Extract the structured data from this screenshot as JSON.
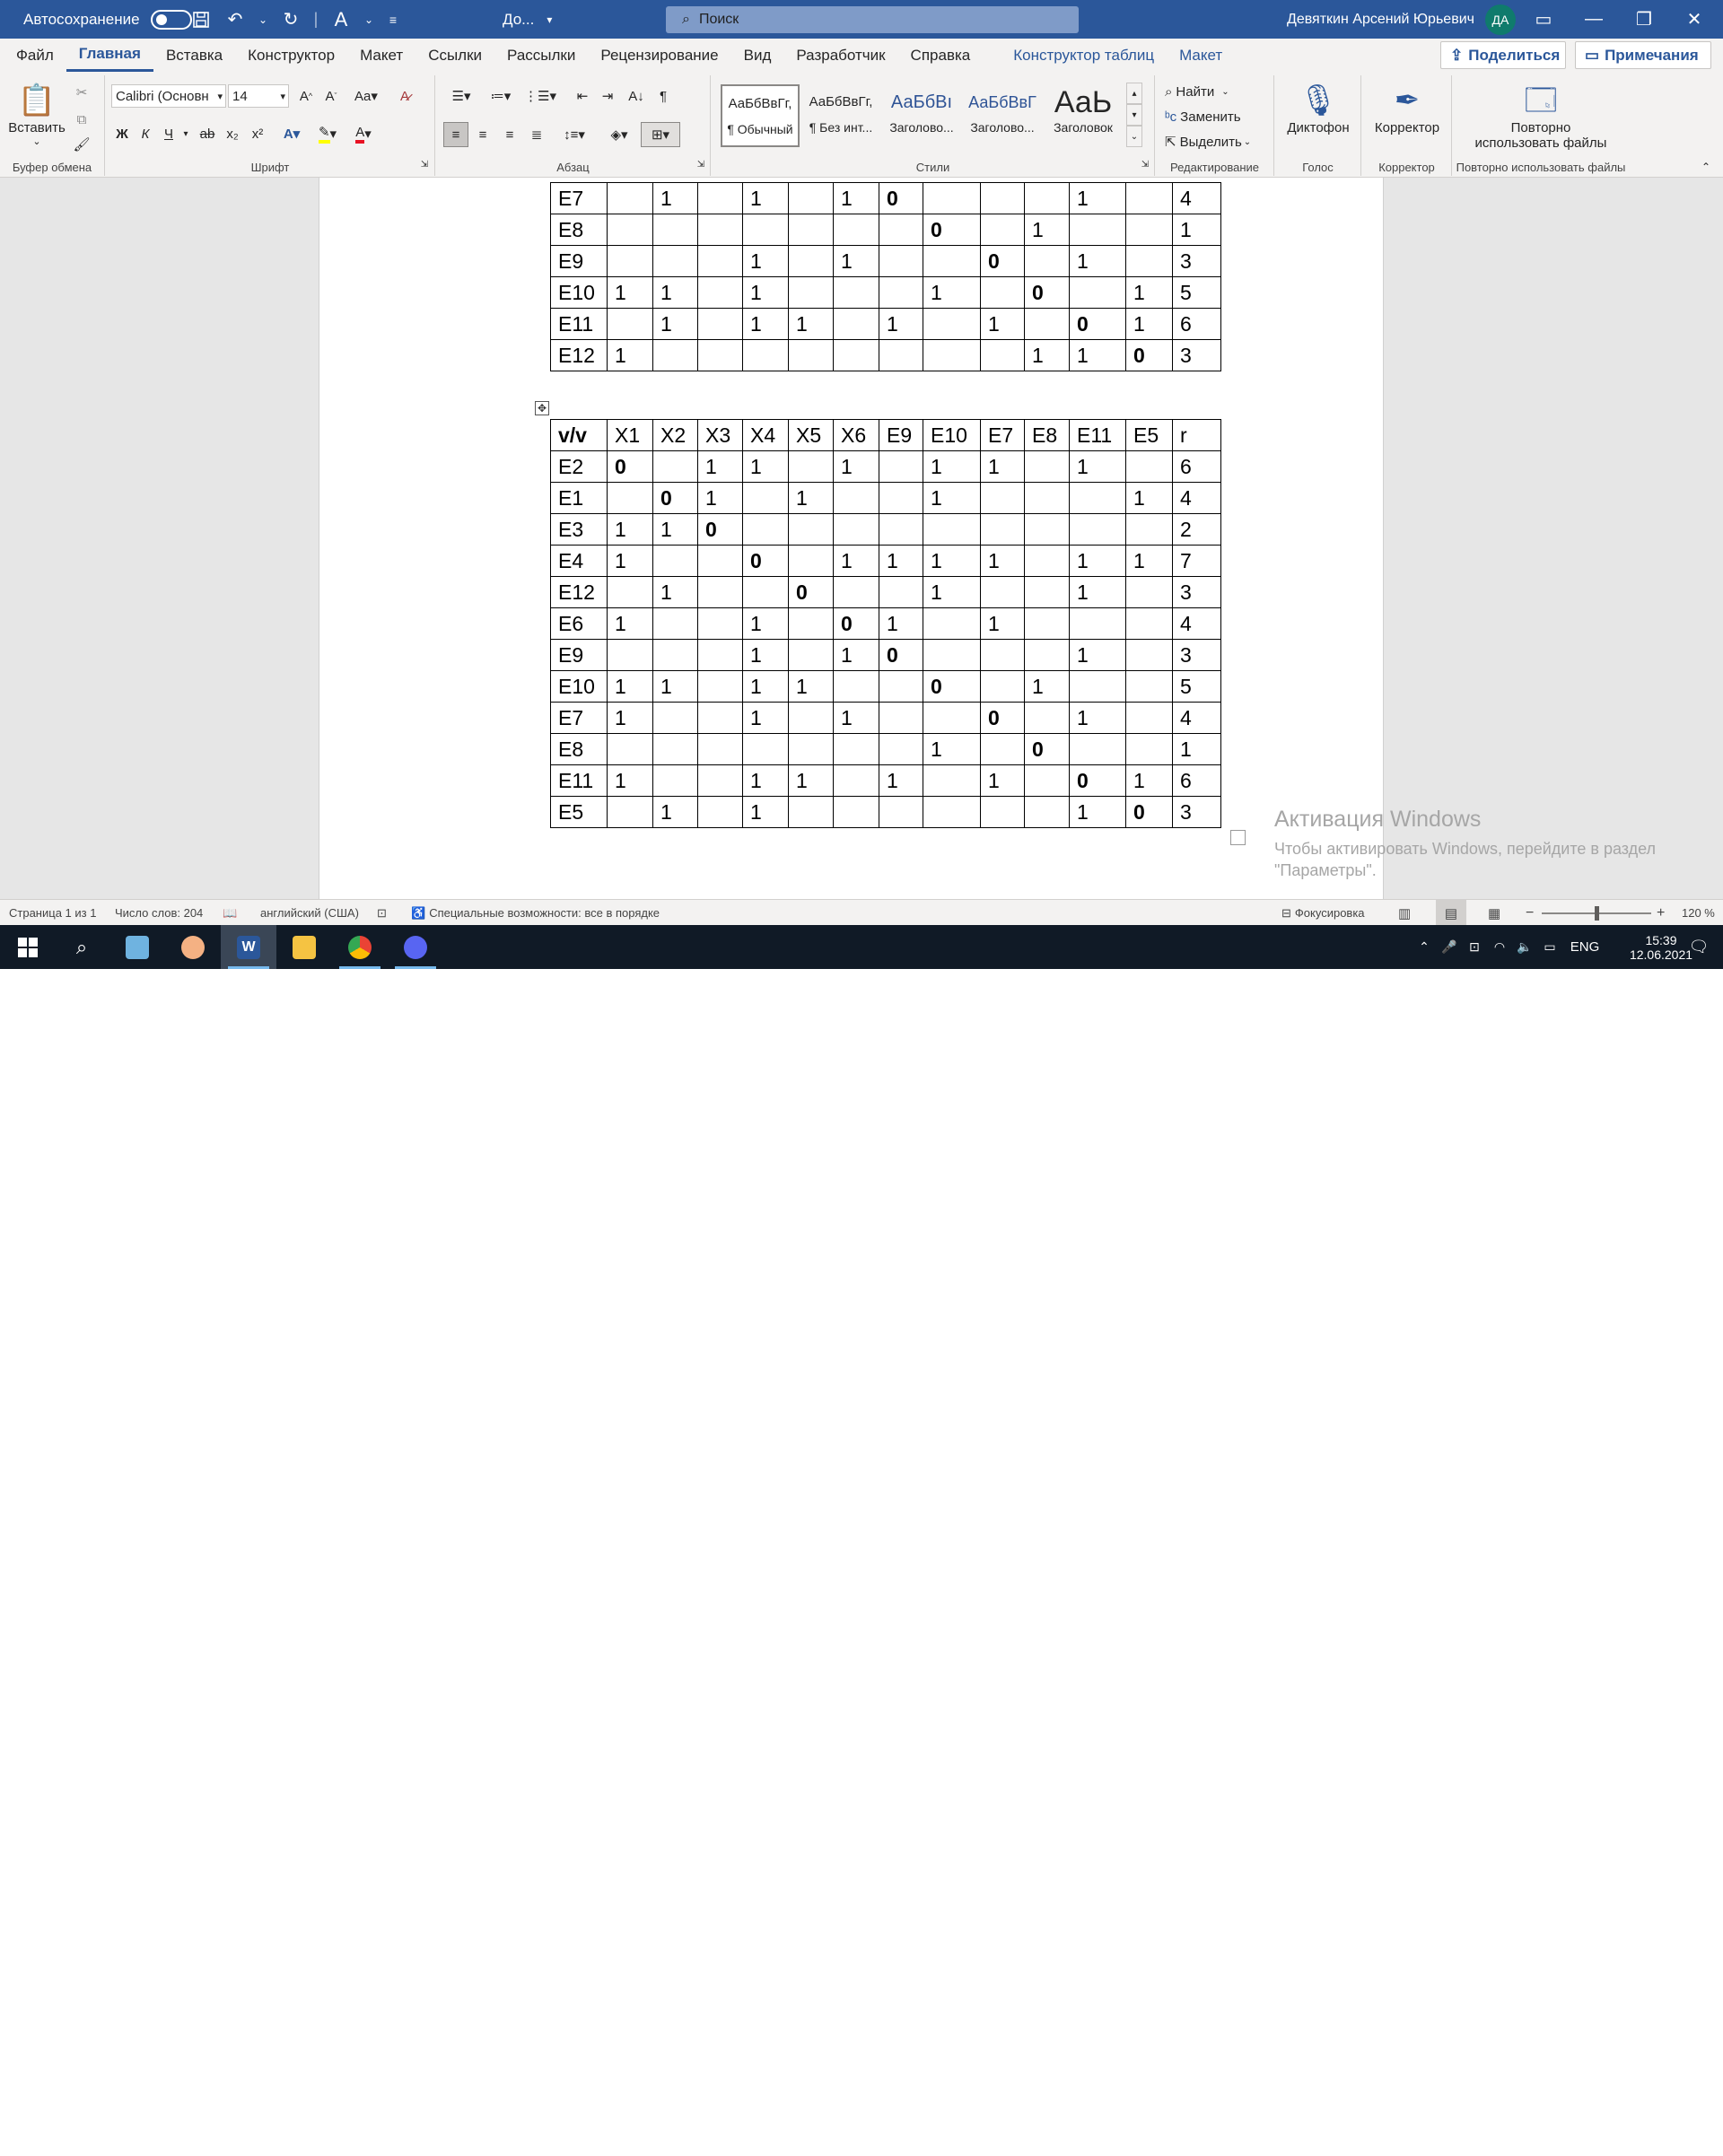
{
  "titlebar": {
    "autosave_label": "Автосохранение",
    "doc_name": "До...",
    "search_placeholder": "Поиск",
    "user_name": "Девяткин Арсений Юрьевич",
    "user_initials": "ДА"
  },
  "tabs": [
    "Файл",
    "Главная",
    "Вставка",
    "Конструктор",
    "Макет",
    "Ссылки",
    "Рассылки",
    "Рецензирование",
    "Вид",
    "Разработчик",
    "Справка",
    "Конструктор таблиц",
    "Макет"
  ],
  "share_label": "Поделиться",
  "comments_label": "Примечания",
  "ribbon": {
    "clipboard": {
      "paste": "Вставить",
      "label": "Буфер обмена"
    },
    "font": {
      "name": "Calibri (Основн",
      "size": "14",
      "label": "Шрифт",
      "bold": "Ж",
      "italic": "К",
      "underline": "Ч"
    },
    "paragraph": {
      "label": "Абзац"
    },
    "styles": {
      "label": "Стили",
      "items": [
        {
          "preview": "АаБбВвГг,",
          "name": "¶ Обычный"
        },
        {
          "preview": "АаБбВвГг,",
          "name": "¶ Без инт..."
        },
        {
          "preview": "АаБбВı",
          "name": "Заголово..."
        },
        {
          "preview": "АаБбВвГ",
          "name": "Заголово..."
        },
        {
          "preview": "АаЬ",
          "name": "Заголовок"
        }
      ]
    },
    "editing": {
      "find": "Найти",
      "replace": "Заменить",
      "select": "Выделить",
      "label": "Редактирование"
    },
    "voice": {
      "dictate": "Диктофон",
      "label": "Голос"
    },
    "editor": {
      "name": "Корректор",
      "label": "Корректор"
    },
    "reuse": {
      "name_line1": "Повторно",
      "name_line2": "использовать файлы",
      "label": "Повторно использовать файлы"
    }
  },
  "table1": {
    "rows": [
      {
        "cells": [
          "E7",
          "",
          "1",
          "",
          "1",
          "",
          "1",
          "0",
          "",
          "",
          "",
          "1",
          "",
          "4"
        ],
        "bold": [
          7
        ]
      },
      {
        "cells": [
          "E8",
          "",
          "",
          "",
          "",
          "",
          "",
          "",
          "0",
          "",
          "1",
          "",
          "",
          "1"
        ],
        "bold": [
          8
        ]
      },
      {
        "cells": [
          "E9",
          "",
          "",
          "",
          "1",
          "",
          "1",
          "",
          "",
          "0",
          "",
          "1",
          "",
          "3"
        ],
        "bold": [
          9
        ]
      },
      {
        "cells": [
          "E10",
          "1",
          "1",
          "",
          "1",
          "",
          "",
          "",
          "1",
          "",
          "0",
          "",
          "1",
          "5"
        ],
        "bold": [
          10
        ]
      },
      {
        "cells": [
          "E11",
          "",
          "1",
          "",
          "1",
          "1",
          "",
          "1",
          "",
          "1",
          "",
          "0",
          "1",
          "6"
        ],
        "bold": [
          11
        ]
      },
      {
        "cells": [
          "E12",
          "1",
          "",
          "",
          "",
          "",
          "",
          "",
          "",
          "",
          "1",
          "1",
          "0",
          "3"
        ],
        "bold": [
          12
        ]
      }
    ]
  },
  "table2": {
    "header": [
      "v/v",
      "X1",
      "X2",
      "X3",
      "X4",
      "X5",
      "X6",
      "E9",
      "E10",
      "E7",
      "E8",
      "E11",
      "E5",
      "r"
    ],
    "rows": [
      {
        "cells": [
          "E2",
          "0",
          "",
          "1",
          "1",
          "",
          "1",
          "",
          "1",
          "1",
          "",
          "1",
          "",
          "6"
        ],
        "bold": [
          1
        ]
      },
      {
        "cells": [
          "E1",
          "",
          "0",
          "1",
          "",
          "1",
          "",
          "",
          "1",
          "",
          "",
          "",
          "1",
          "4"
        ],
        "bold": [
          2
        ]
      },
      {
        "cells": [
          "E3",
          "1",
          "1",
          "0",
          "",
          "",
          "",
          "",
          "",
          "",
          "",
          "",
          "",
          "2"
        ],
        "bold": [
          3
        ]
      },
      {
        "cells": [
          "E4",
          "1",
          "",
          "",
          "0",
          "",
          "1",
          "1",
          "1",
          "1",
          "",
          "1",
          "1",
          "7"
        ],
        "bold": [
          4
        ]
      },
      {
        "cells": [
          "E12",
          "",
          "1",
          "",
          "",
          "0",
          "",
          "",
          "1",
          "",
          "",
          "1",
          "",
          "3"
        ],
        "bold": [
          5
        ]
      },
      {
        "cells": [
          "E6",
          "1",
          "",
          "",
          "1",
          "",
          "0",
          "1",
          "",
          "1",
          "",
          "",
          "",
          "4"
        ],
        "bold": [
          6
        ]
      },
      {
        "cells": [
          "E9",
          "",
          "",
          "",
          "1",
          "",
          "1",
          "0",
          "",
          "",
          "",
          "1",
          "",
          "3"
        ],
        "bold": [
          7
        ]
      },
      {
        "cells": [
          "E10",
          "1",
          "1",
          "",
          "1",
          "1",
          "",
          "",
          "0",
          "",
          "1",
          "",
          "",
          "5"
        ],
        "bold": [
          8
        ]
      },
      {
        "cells": [
          "E7",
          "1",
          "",
          "",
          "1",
          "",
          "1",
          "",
          "",
          "0",
          "",
          "1",
          "",
          "4"
        ],
        "bold": [
          9
        ]
      },
      {
        "cells": [
          "E8",
          "",
          "",
          "",
          "",
          "",
          "",
          "",
          "1",
          "",
          "0",
          "",
          "",
          "1"
        ],
        "bold": [
          10
        ]
      },
      {
        "cells": [
          "E11",
          "1",
          "",
          "",
          "1",
          "1",
          "",
          "1",
          "",
          "1",
          "",
          "0",
          "1",
          "6"
        ],
        "bold": [
          11
        ]
      },
      {
        "cells": [
          "E5",
          "",
          "1",
          "",
          "1",
          "",
          "",
          "",
          "",
          "",
          "",
          "1",
          "0",
          "3"
        ],
        "bold": [
          12
        ]
      }
    ]
  },
  "watermark": {
    "title": "Активация Windows",
    "line1": "Чтобы активировать Windows, перейдите в раздел",
    "line2": "\"Параметры\"."
  },
  "statusbar": {
    "page": "Страница 1 из 1",
    "words": "Число слов: 204",
    "language": "английский (США)",
    "accessibility": "Специальные возможности: все в порядке",
    "focus": "Фокусировка",
    "zoom": "120 %"
  },
  "taskbar": {
    "language": "ENG",
    "time": "15:39",
    "date": "12.06.2021"
  },
  "colors": {
    "word_blue": "#2b579a",
    "taskbar": "#101a26"
  }
}
